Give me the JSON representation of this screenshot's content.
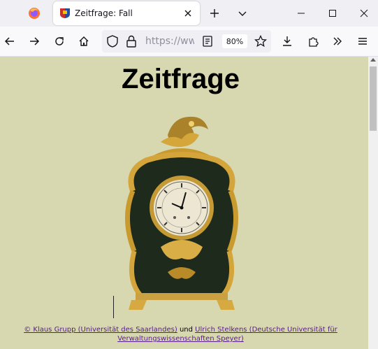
{
  "browser": {
    "tab": {
      "title": "Zeitfrage: Fall"
    },
    "url": "https://www",
    "zoom": "80%"
  },
  "page": {
    "title": "Zeitfrage",
    "footer": {
      "author1_link": "© Klaus Grupp (Universität des Saarlandes)",
      "connector": " und ",
      "author2_link": "Ulrich Stelkens (Deutsche Universität für Verwaltungswissenschaften Speyer)"
    }
  },
  "colors": {
    "page_background": "#d8d8b0",
    "link": "#551a8b"
  },
  "icons": [
    "firefox-icon",
    "site-favicon",
    "close-icon",
    "new-tab-icon",
    "list-all-tabs-icon",
    "minimize-icon",
    "maximize-icon",
    "window-close-icon",
    "back-icon",
    "forward-icon",
    "reload-icon",
    "home-icon",
    "shield-icon",
    "lock-icon",
    "reader-view-icon",
    "bookmark-star-icon",
    "downloads-icon",
    "extensions-icon",
    "overflow-icon",
    "menu-icon"
  ]
}
